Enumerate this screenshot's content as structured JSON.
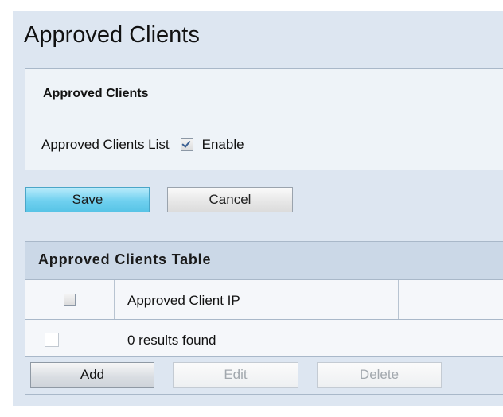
{
  "page": {
    "title": "Approved Clients"
  },
  "settings": {
    "heading": "Approved Clients",
    "list_label": "Approved Clients List",
    "enable_label": "Enable",
    "enabled": true
  },
  "actions": {
    "save_label": "Save",
    "cancel_label": "Cancel"
  },
  "table": {
    "title": "Approved Clients Table",
    "columns": [
      "",
      "Approved Client IP",
      ""
    ],
    "empty_message": "0 results found",
    "add_label": "Add",
    "edit_label": "Edit",
    "delete_label": "Delete"
  },
  "colors": {
    "page_background": "#dde6f1",
    "save_button": "#6fd0ef",
    "table_header": "#cbd8e7"
  }
}
